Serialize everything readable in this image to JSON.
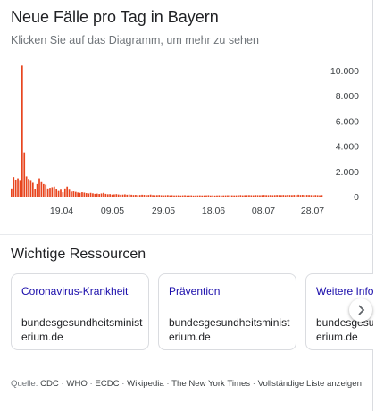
{
  "header": {
    "title": "Neue Fälle pro Tag in Bayern",
    "subtitle": "Klicken Sie auf das Diagramm, um mehr zu sehen"
  },
  "chart_data": {
    "type": "bar",
    "x_ticks": [
      "19.04",
      "09.05",
      "29.05",
      "18.06",
      "08.07",
      "28.07"
    ],
    "y_ticks": [
      "10.000",
      "8.000",
      "6.000",
      "4.000",
      "2.000",
      "0"
    ],
    "y_tick_values": [
      10000,
      8000,
      6000,
      4000,
      2000,
      0
    ],
    "ylim": [
      0,
      10500
    ],
    "bar_color": "#e8451e",
    "series": [
      {
        "values": [
          650,
          1550,
          1350,
          1450,
          1250,
          10400,
          3500,
          1600,
          1400,
          1250,
          1100,
          600,
          1000,
          1450,
          1150,
          1000,
          950,
          650,
          700,
          750,
          800,
          600,
          450,
          550,
          350,
          650,
          800,
          550,
          400,
          420,
          380,
          330,
          300,
          350,
          320,
          280,
          250,
          300,
          260,
          220,
          240,
          210,
          250,
          300,
          220,
          190,
          200,
          160,
          180,
          200,
          170,
          150,
          160,
          180,
          150,
          170,
          150,
          130,
          140,
          120,
          130,
          150,
          140,
          120,
          130,
          160,
          120,
          110,
          120,
          130,
          110,
          100,
          110,
          120,
          100,
          110,
          95,
          100,
          105,
          90,
          100,
          110,
          90,
          95,
          100,
          85,
          90,
          95,
          100,
          90,
          95,
          100,
          110,
          90,
          100,
          85,
          95,
          100,
          90,
          95,
          100,
          105,
          110,
          100,
          95,
          100,
          110,
          120,
          100,
          110,
          115,
          120,
          110,
          105,
          120,
          115,
          110,
          120,
          130,
          120,
          115,
          125,
          110,
          120,
          130,
          125,
          120,
          130,
          115,
          140,
          130,
          120,
          135,
          125,
          150,
          130,
          140,
          120,
          135,
          130,
          120,
          110,
          125,
          115,
          105,
          120
        ]
      }
    ]
  },
  "resources": {
    "title": "Wichtige Ressourcen",
    "cards": [
      {
        "title": "Coronavirus-Krankheit",
        "domain": "bundesgesundheitsministerium.de"
      },
      {
        "title": "Prävention",
        "domain": "bundesgesundheitsministerium.de"
      },
      {
        "title": "Weitere Informationen",
        "domain": "bundesgesundheitsministerium.de"
      }
    ]
  },
  "footer": {
    "lead": "Quelle:",
    "sources": [
      "CDC",
      "WHO",
      "ECDC",
      "Wikipedia",
      "The New York Times",
      "Vollständige Liste anzeigen"
    ]
  }
}
